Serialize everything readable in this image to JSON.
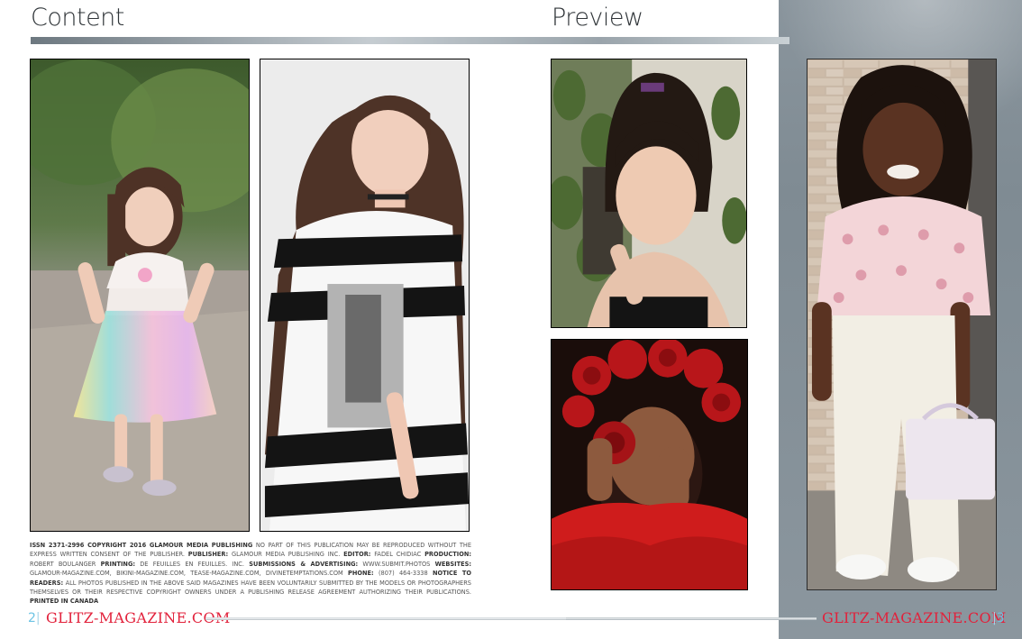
{
  "headings": {
    "content": "Content",
    "preview": "Preview"
  },
  "colophon": [
    {
      "t": "ISSN 2371-2996 COPYRIGHT 2016 GLAMOUR MEDIA PUBLISHING",
      "b": true
    },
    {
      "t": " NO PART OF THIS PUBLICATION MAY BE REPRODUCED WITHOUT THE EXPRESS WRITTEN CONSENT OF THE PUBLISHER. ",
      "b": false
    },
    {
      "t": "PUBLISHER:",
      "b": true
    },
    {
      "t": " GLAMOUR MEDIA PUBLISHING INC. ",
      "b": false
    },
    {
      "t": "EDITOR:",
      "b": true
    },
    {
      "t": " FADEL CHIDIAC ",
      "b": false
    },
    {
      "t": "PRODUCTION:",
      "b": true
    },
    {
      "t": " ROBERT BOULANGER ",
      "b": false
    },
    {
      "t": "PRINTING:",
      "b": true
    },
    {
      "t": " DE FEUILLES EN FEUILLES. INC. ",
      "b": false
    },
    {
      "t": "SUBMISSIONS & ADVERTISING:",
      "b": true
    },
    {
      "t": " WWW.SUBMIT.PHOTOS ",
      "b": false
    },
    {
      "t": "WEBSITES:",
      "b": true
    },
    {
      "t": " GLAMOUR-MAGAZINE.COM, BIKINI-MAGAZINE.COM, TEASE-MAGAZINE.COM, DIVINETEMPTATIONS.COM ",
      "b": false
    },
    {
      "t": "PHONE:",
      "b": true
    },
    {
      "t": " (807) 464-3338 ",
      "b": false
    },
    {
      "t": "NOTICE TO READERS:",
      "b": true
    },
    {
      "t": " ALL PHOTOS PUBLISHED IN THE ABOVE SAID MAGAZINES HAVE BEEN VOLUNTARILY SUBMITTED BY THE MODELS OR PHOTOGRAPHERS THEMSELVES OR THEIR RESPECTIVE COPYRIGHT OWNERS UNDER A PUBLISHING RELEASE AGREEMENT AUTHORIZING THEIR PUBLICATIONS. ",
      "b": false
    },
    {
      "t": "PRINTED IN CANADA",
      "b": true
    }
  ],
  "footer": {
    "left_page": "2",
    "right_page": "3",
    "pipe": "|",
    "brand_left": "GLITZ-MAGAZINE.COM",
    "brand_right": "GLITZ-MAGAZINE.COM"
  },
  "colors": {
    "brand": "#e2213b",
    "page_number": "#6cc3e4",
    "panel": "#858f97"
  }
}
